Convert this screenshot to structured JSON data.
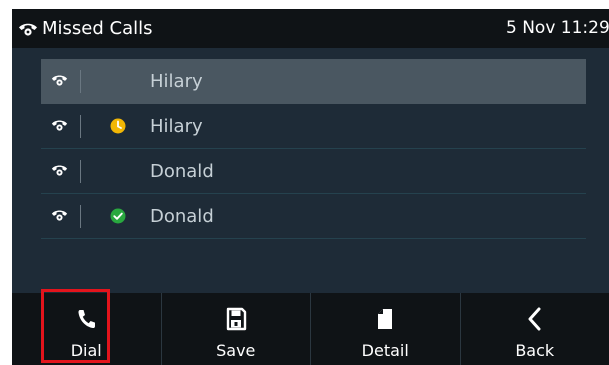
{
  "header": {
    "title": "Missed Calls",
    "datetime": "5 Nov 11:29",
    "title_icon": "missed-call-icon"
  },
  "calls": [
    {
      "name": "Hilary",
      "status_icon": "",
      "selected": true
    },
    {
      "name": "Hilary",
      "status_icon": "clock-icon",
      "selected": false
    },
    {
      "name": "Donald",
      "status_icon": "",
      "selected": false
    },
    {
      "name": "Donald",
      "status_icon": "check-icon",
      "selected": false
    }
  ],
  "softkeys": [
    {
      "label": "Dial",
      "icon": "phone-icon"
    },
    {
      "label": "Save",
      "icon": "save-icon"
    },
    {
      "label": "Detail",
      "icon": "document-icon"
    },
    {
      "label": "Back",
      "icon": "chevron-left-icon"
    }
  ],
  "colors": {
    "screen_bg": "#1e2b37",
    "bar_bg": "#0f1316",
    "selected_row": "#4a5761",
    "clock_status": "#f2b705",
    "check_status": "#29a83f",
    "highlight_box": "#e3141c"
  }
}
